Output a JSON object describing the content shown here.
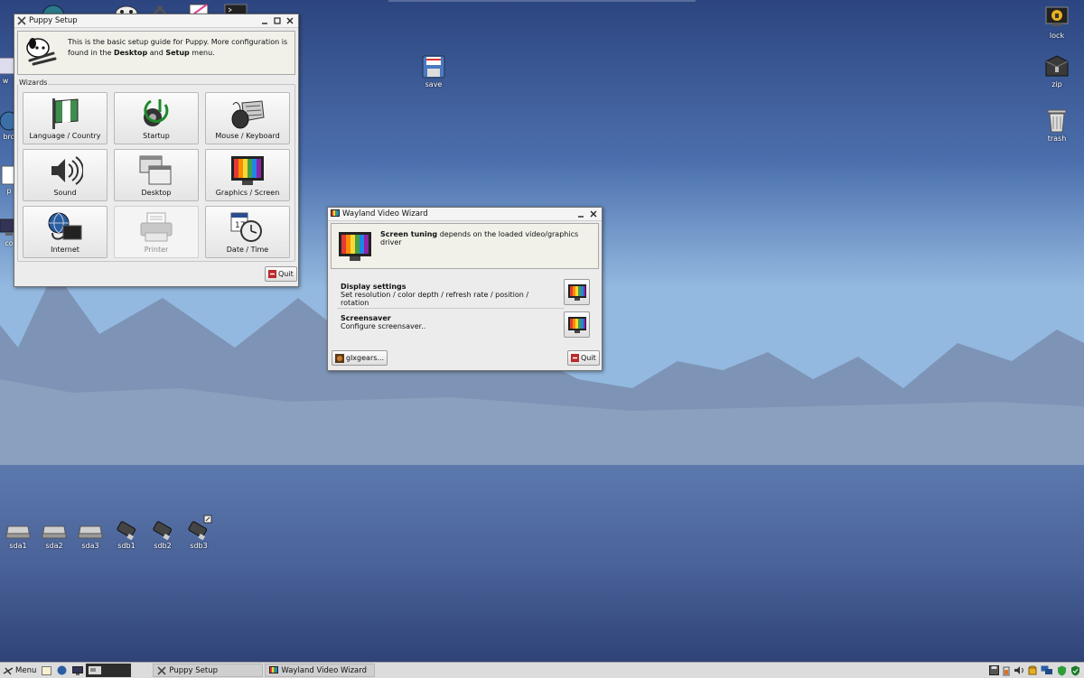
{
  "desktop": {
    "left_icons": [
      {
        "label": "w"
      },
      {
        "label": "bro"
      },
      {
        "label": "p"
      },
      {
        "label": "co"
      }
    ],
    "right_icons": [
      {
        "label": "lock"
      },
      {
        "label": "zip"
      },
      {
        "label": "trash"
      }
    ],
    "save_icon": {
      "label": "save"
    },
    "drives": [
      {
        "label": "sda1"
      },
      {
        "label": "sda2"
      },
      {
        "label": "sda3"
      },
      {
        "label": "sdb1"
      },
      {
        "label": "sdb2"
      },
      {
        "label": "sdb3"
      }
    ]
  },
  "puppy_setup": {
    "title": "Puppy Setup",
    "intro_pre": "This is the basic setup guide for Puppy. More configuration is found in the ",
    "intro_bold1": "Desktop",
    "intro_mid": " and ",
    "intro_bold2": "Setup",
    "intro_post": " menu.",
    "wizards_label": "Wizards",
    "wizards": [
      {
        "label": "Language / Country"
      },
      {
        "label": "Startup"
      },
      {
        "label": "Mouse / Keyboard"
      },
      {
        "label": "Sound"
      },
      {
        "label": "Desktop"
      },
      {
        "label": "Graphics / Screen"
      },
      {
        "label": "Internet"
      },
      {
        "label": "Printer"
      },
      {
        "label": "Date / Time"
      }
    ],
    "quit_label": "Quit"
  },
  "video_wizard": {
    "title": "Wayland Video Wizard",
    "header_bold": "Screen tuning",
    "header_rest": " depends on the loaded video/graphics driver",
    "items": [
      {
        "title": "Display settings",
        "desc": "Set resolution / color depth / refresh rate / position / rotation"
      },
      {
        "title": "Screensaver",
        "desc": "Configure screensaver.."
      }
    ],
    "glxgears_label": "glxgears...",
    "quit_label": "Quit"
  },
  "taskbar": {
    "menu_label": "Menu",
    "tasks": [
      {
        "label": "Puppy Setup"
      },
      {
        "label": "Wayland Video Wizard"
      }
    ]
  }
}
